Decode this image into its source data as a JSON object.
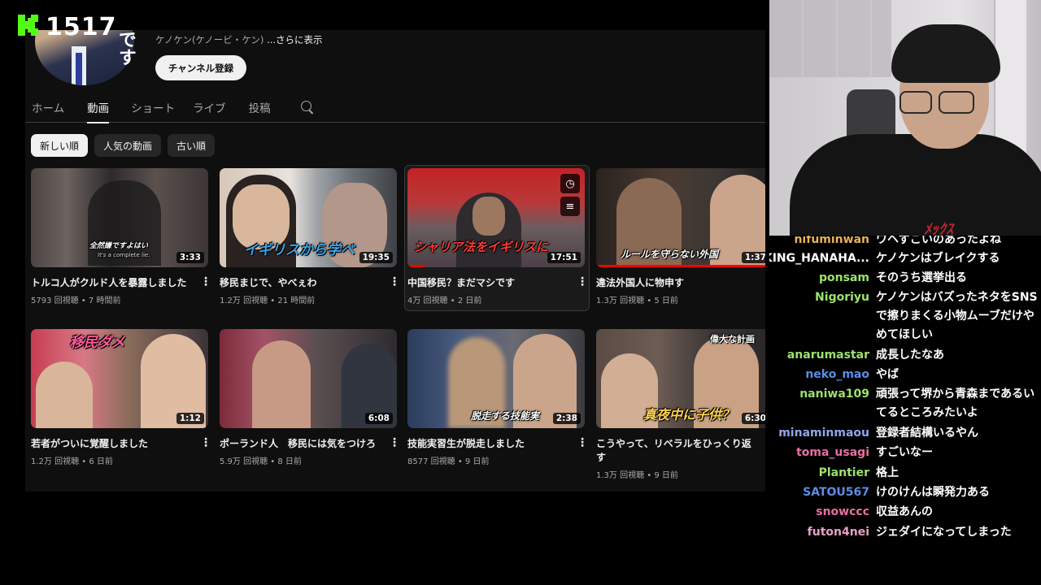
{
  "overlay": {
    "viewer_count": "1517",
    "accent": "#53fc18"
  },
  "channel": {
    "avatar_text": "です",
    "desc_name": "ケノケン(ケノービ・ケン) ",
    "desc_more": "...さらに表示",
    "subscribe_label": "チャンネル登録"
  },
  "tabs": [
    "ホーム",
    "動画",
    "ショート",
    "ライブ",
    "投稿"
  ],
  "active_tab": "動画",
  "chips": [
    "新しい順",
    "人気の動画",
    "古い順"
  ],
  "videos": [
    {
      "title": "トルコ人がクルド人を暴露しました",
      "views": "5793 回視聴",
      "age": "7 時間前",
      "duration": "3:33",
      "caption": "全然嫌ですよはい",
      "caption2": "It's a complete lie."
    },
    {
      "title": "移民まじで、やべぇわ",
      "views": "1.2万 回視聴",
      "age": "21 時間前",
      "duration": "19:35",
      "caption": "イギリスから学べ"
    },
    {
      "title": "中国移民？まだマシです",
      "views": "4万 回視聴",
      "age": "2 日前",
      "duration": "17:51",
      "caption": "シャリア法をイギリスに"
    },
    {
      "title": "違法外国人に物申す",
      "views": "1.3万 回視聴",
      "age": "5 日前",
      "duration": "1:37",
      "caption": "ルールを守らない外国"
    },
    {
      "title": "若者がついに覚醒しました",
      "views": "1.2万 回視聴",
      "age": "6 日前",
      "duration": "1:12",
      "caption": "移民ダメ"
    },
    {
      "title": "ポーランド人　移民には気をつけろ",
      "views": "5.9万 回視聴",
      "age": "8 日前",
      "duration": "6:08",
      "caption": ""
    },
    {
      "title": "技能実習生が脱走しました",
      "views": "8577 回視聴",
      "age": "9 日前",
      "duration": "2:38",
      "caption": "脱走する技能実"
    },
    {
      "title": "こうやって、リベラルをひっくり返す",
      "views": "1.3万 回視聴",
      "age": "9 日前",
      "duration": "6:30",
      "caption": "真夜中に子供？",
      "caption2": "偉大な計画"
    }
  ],
  "webcam": {
    "shirt_print": "ﾒｯｸｽ"
  },
  "chat": [
    {
      "user": "nifuminwan",
      "color": "#e7b35a",
      "text": "ワヘずごいのあったよね"
    },
    {
      "user": "KING_HANAHA...",
      "color": "#ffffff",
      "text": "ケノケンはブレイクする"
    },
    {
      "user": "ponsam",
      "color": "#9de36d",
      "text": "そのうち選挙出る"
    },
    {
      "user": "Nigoriyu",
      "color": "#9de36d",
      "text": "ケノケンはバズったネタをSNSで擦りまくる小物ムーブだけやめてほしい"
    },
    {
      "user": "anarumastar",
      "color": "#9de36d",
      "text": "成長したなあ"
    },
    {
      "user": "neko_mao",
      "color": "#5b8de6",
      "text": "やば"
    },
    {
      "user": "naniwa109",
      "color": "#9de36d",
      "text": "頑張って堺から青森まであるいてるところみたいよ"
    },
    {
      "user": "minaminmaou",
      "color": "#8fa6e8",
      "text": "登録者結構いるやん"
    },
    {
      "user": "toma_usagi",
      "color": "#e66fa3",
      "text": "すごいなー"
    },
    {
      "user": "Plantier",
      "color": "#9de36d",
      "text": "格上"
    },
    {
      "user": "SATOU567",
      "color": "#5b8de6",
      "text": "けのけんは瞬発力ある"
    },
    {
      "user": "snowccc",
      "color": "#e66fa3",
      "text": "収益あんの"
    },
    {
      "user": "futon4nei",
      "color": "#e8a0c8",
      "text": "ジェダイになってしまった"
    }
  ]
}
